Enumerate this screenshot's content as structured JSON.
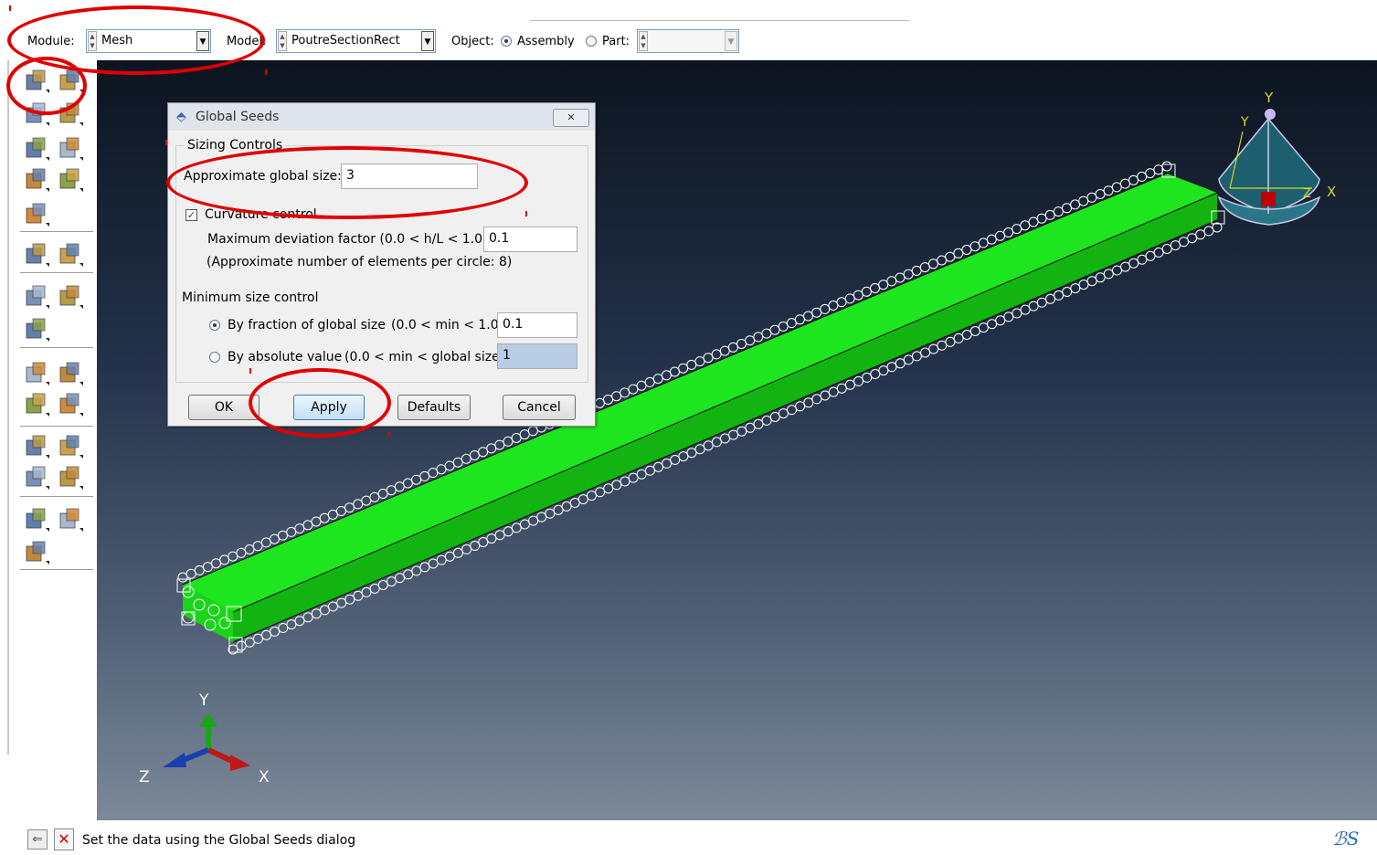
{
  "context_bar": {
    "module_label": "Module:",
    "module_value": "Mesh",
    "model_label": "Model:",
    "model_value": "PoutreSectionRect",
    "object_label": "Object:",
    "assembly_label": "Assembly",
    "part_label": "Part:",
    "part_value": ""
  },
  "dialog": {
    "title": "Global Seeds",
    "group_title": "Sizing Controls",
    "approx_size_label": "Approximate global size:",
    "approx_size_value": "3",
    "curvature_label": "Curvature control",
    "curvature_checked": true,
    "max_dev_label": "Maximum deviation factor (0.0 < h/L < 1.0):",
    "max_dev_value": "0.1",
    "approx_elements_text": "(Approximate number of elements per circle: 8)",
    "min_size_label": "Minimum size control",
    "by_fraction_label": "By fraction of global size",
    "by_fraction_range": "(0.0 < min < 1.0)",
    "by_fraction_value": "0.1",
    "by_absolute_label": "By absolute value",
    "by_absolute_range": "(0.0 < min < global size)",
    "by_absolute_value": "1",
    "selected_min_option": "fraction",
    "buttons": {
      "ok": "OK",
      "apply": "Apply",
      "defaults": "Defaults",
      "cancel": "Cancel"
    }
  },
  "triad_main": {
    "x": "X",
    "y": "Y",
    "z": "Z"
  },
  "triad_view": {
    "x": "X",
    "y": "Y",
    "y2": "Y",
    "z": "Z"
  },
  "status": {
    "message": "Set the data using the Global Seeds dialog"
  },
  "colors": {
    "beam": "#1ee61e",
    "highlight": "#e00000",
    "bg_top": "#0c1420",
    "bg_bottom": "#7b8999"
  },
  "toolbox": {
    "icons": [
      "seed-part-icon",
      "seed-edge-icon",
      "mesh-controls-icon",
      "element-type-icon",
      "mesh-part-icon",
      "mesh-region-icon",
      "assign-stack-icon",
      "verify-mesh-icon",
      "partition-cell-icon",
      "virtual-topology-icon",
      "query-icon",
      "edit-mesh-icon",
      "node-edit-icon",
      "element-edit-icon",
      "create-set-icon",
      "select-icon",
      "transform-icon",
      "datum-point-icon",
      "datum-axis-icon",
      "datum-plane-icon",
      "datum-csys-icon",
      "sweep-icon",
      "mesh-on-part-icon",
      "partition-face-icon",
      "tools-icon"
    ]
  }
}
